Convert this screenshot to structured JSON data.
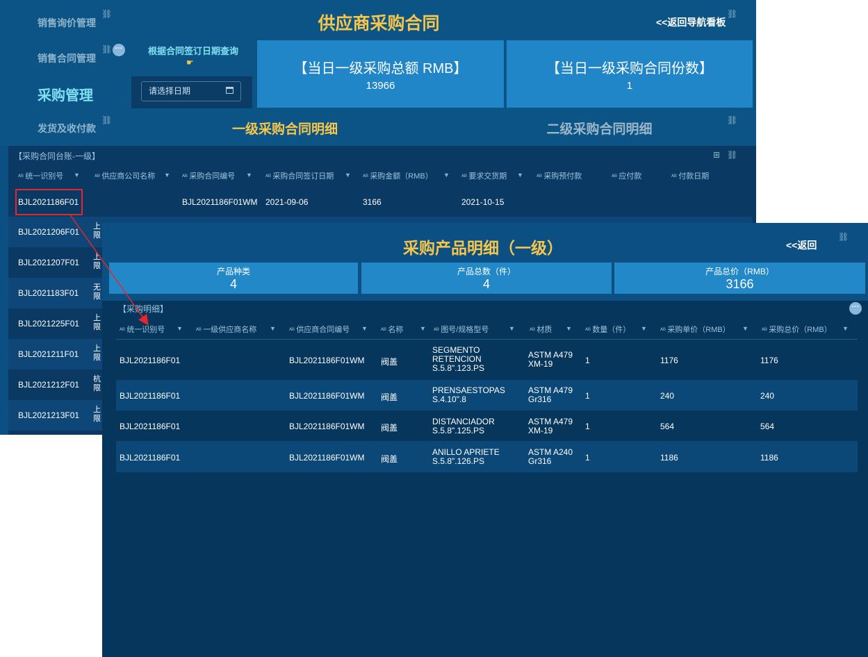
{
  "dashboard": {
    "title": "供应商采购合同",
    "back_nav": "<<返回导航看板",
    "sidebar": [
      {
        "label": "销售询价管理"
      },
      {
        "label": "销售合同管理"
      },
      {
        "label": "采购管理"
      },
      {
        "label": "发货及收付款"
      }
    ],
    "date_query_label": "根据合同签订日期查询",
    "date_placeholder": "请选择日期",
    "kpis": [
      {
        "label": "【当日一级采购总额 RMB】",
        "value": "13966"
      },
      {
        "label": "【当日一级采购合同份数】",
        "value": "1"
      }
    ],
    "tabs": [
      {
        "label": "一级采购合同明细"
      },
      {
        "label": "二级采购合同明细"
      }
    ],
    "ledger": {
      "title": "【采购合同台账-一级】",
      "columns": [
        "统一识别号",
        "供应商公司名称",
        "采购合同编号",
        "采购合同签订日期",
        "采购金额（RMB）",
        "要求交货期",
        "采购预付款",
        "应付款",
        "付款日期"
      ],
      "rows": [
        {
          "id": "BJL2021186F01",
          "supplier": "",
          "contract": "BJL2021186F01WM",
          "date": "2021-09-06",
          "amount": "3166",
          "delivery": "2021-10-15"
        },
        {
          "id": "BJL2021206F01",
          "supplier": "上\n限"
        },
        {
          "id": "BJL2021207F01",
          "supplier": "上\n限"
        },
        {
          "id": "BJL2021183F01",
          "supplier": "无\n限"
        },
        {
          "id": "BJL2021225F01",
          "supplier": "上\n限"
        },
        {
          "id": "BJL2021211F01",
          "supplier": "上\n限"
        },
        {
          "id": "BJL2021212F01",
          "supplier": "杭\n限"
        },
        {
          "id": "BJL2021213F01",
          "supplier": "上\n限"
        }
      ]
    }
  },
  "popup": {
    "title": "采购产品明细（一级）",
    "back": "<<返回",
    "kpis": [
      {
        "label": "产品种类",
        "value": "4"
      },
      {
        "label": "产品总数（件）",
        "value": "4"
      },
      {
        "label": "产品总价（RMB）",
        "value": "3166"
      }
    ],
    "detail_title": "【采购明细】",
    "columns": [
      "统一识别号",
      "一级供应商名称",
      "供应商合同编号",
      "名称",
      "图号/规格型号",
      "材质",
      "数量（件）",
      "采购单价（RMB）",
      "采购总价（RMB）"
    ],
    "rows": [
      {
        "id": "BJL2021186F01",
        "supplier": "",
        "contract": "BJL2021186F01WM",
        "name": "阀盖",
        "spec": "SEGMENTO\nRETENCION\nS.5.8\".123.PS",
        "material": "ASTM A479\nXM-19",
        "qty": "1",
        "unit": "1176",
        "total": "1176"
      },
      {
        "id": "BJL2021186F01",
        "supplier": "",
        "contract": "BJL2021186F01WM",
        "name": "阀盖",
        "spec": "PRENSAESTOPAS\nS.4.10\".8",
        "material": "ASTM A479\nGr316",
        "qty": "1",
        "unit": "240",
        "total": "240"
      },
      {
        "id": "BJL2021186F01",
        "supplier": "",
        "contract": "BJL2021186F01WM",
        "name": "阀盖",
        "spec": "DISTANCIADOR\nS.5.8\".125.PS",
        "material": "ASTM A479\nXM-19",
        "qty": "1",
        "unit": "564",
        "total": "564"
      },
      {
        "id": "BJL2021186F01",
        "supplier": "",
        "contract": "BJL2021186F01WM",
        "name": "阀盖",
        "spec": "ANILLO APRIETE\nS.5.8\".126.PS",
        "material": "ASTM A240\nGr316",
        "qty": "1",
        "unit": "1186",
        "total": "1186"
      }
    ]
  },
  "colors": {
    "panel_bg": "#0c5083",
    "kpi_bg": "#2186c7",
    "title_yellow": "#f5c64a",
    "highlight_red": "#e0282e"
  }
}
